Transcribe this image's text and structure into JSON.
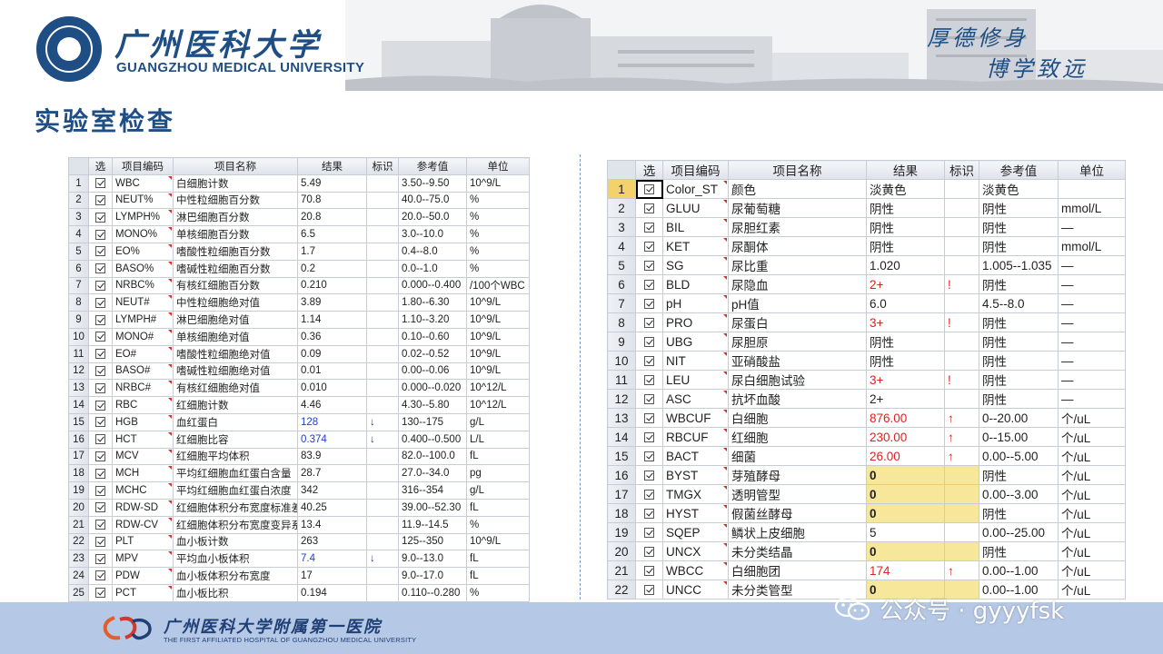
{
  "header": {
    "university_cn": "广州医科大学",
    "university_en": "GUANGZHOU MEDICAL UNIVERSITY",
    "motto_line1": "厚德修身",
    "motto_line2": "博学致远"
  },
  "title": "实验室检查",
  "table1": {
    "columns": [
      "选",
      "项目编码",
      "项目名称",
      "结果",
      "标识",
      "参考值",
      "单位"
    ],
    "rows": [
      [
        "WBC",
        "白细胞计数",
        "5.49",
        "",
        "3.50--9.50",
        "10^9/L",
        ""
      ],
      [
        "NEUT%",
        "中性粒细胞百分数",
        "70.8",
        "",
        "40.0--75.0",
        "%",
        ""
      ],
      [
        "LYMPH%",
        "淋巴细胞百分数",
        "20.8",
        "",
        "20.0--50.0",
        "%",
        ""
      ],
      [
        "MONO%",
        "单核细胞百分数",
        "6.5",
        "",
        "3.0--10.0",
        "%",
        ""
      ],
      [
        "EO%",
        "嗜酸性粒细胞百分数",
        "1.7",
        "",
        "0.4--8.0",
        "%",
        ""
      ],
      [
        "BASO%",
        "嗜碱性粒细胞百分数",
        "0.2",
        "",
        "0.0--1.0",
        "%",
        ""
      ],
      [
        "NRBC%",
        "有核红细胞百分数",
        "0.210",
        "",
        "0.000--0.400",
        "/100个WBC",
        ""
      ],
      [
        "NEUT#",
        "中性粒细胞绝对值",
        "3.89",
        "",
        "1.80--6.30",
        "10^9/L",
        ""
      ],
      [
        "LYMPH#",
        "淋巴细胞绝对值",
        "1.14",
        "",
        "1.10--3.20",
        "10^9/L",
        ""
      ],
      [
        "MONO#",
        "单核细胞绝对值",
        "0.36",
        "",
        "0.10--0.60",
        "10^9/L",
        ""
      ],
      [
        "EO#",
        "嗜酸性粒细胞绝对值",
        "0.09",
        "",
        "0.02--0.52",
        "10^9/L",
        ""
      ],
      [
        "BASO#",
        "嗜碱性粒细胞绝对值",
        "0.01",
        "",
        "0.00--0.06",
        "10^9/L",
        ""
      ],
      [
        "NRBC#",
        "有核红细胞绝对值",
        "0.010",
        "",
        "0.000--0.020",
        "10^12/L",
        ""
      ],
      [
        "RBC",
        "红细胞计数",
        "4.46",
        "",
        "4.30--5.80",
        "10^12/L",
        ""
      ],
      [
        "HGB",
        "血红蛋白",
        "128",
        "↓",
        "130--175",
        "g/L",
        "low"
      ],
      [
        "HCT",
        "红细胞比容",
        "0.374",
        "↓",
        "0.400--0.500",
        "L/L",
        "low"
      ],
      [
        "MCV",
        "红细胞平均体积",
        "83.9",
        "",
        "82.0--100.0",
        "fL",
        ""
      ],
      [
        "MCH",
        "平均红细胞血红蛋白含量",
        "28.7",
        "",
        "27.0--34.0",
        "pg",
        ""
      ],
      [
        "MCHC",
        "平均红细胞血红蛋白浓度",
        "342",
        "",
        "316--354",
        "g/L",
        ""
      ],
      [
        "RDW-SD",
        "红细胞体积分布宽度标准差",
        "40.25",
        "",
        "39.00--52.30",
        "fL",
        ""
      ],
      [
        "RDW-CV",
        "红细胞体积分布宽度变异系数",
        "13.4",
        "",
        "11.9--14.5",
        "%",
        ""
      ],
      [
        "PLT",
        "血小板计数",
        "263",
        "",
        "125--350",
        "10^9/L",
        ""
      ],
      [
        "MPV",
        "平均血小板体积",
        "7.4",
        "↓",
        "9.0--13.0",
        "fL",
        "low"
      ],
      [
        "PDW",
        "血小板体积分布宽度",
        "17",
        "",
        "9.0--17.0",
        "fL",
        ""
      ],
      [
        "PCT",
        "血小板比积",
        "0.194",
        "",
        "0.110--0.280",
        "%",
        ""
      ]
    ]
  },
  "table2": {
    "columns": [
      "选",
      "项目编码",
      "项目名称",
      "结果",
      "标识",
      "参考值",
      "单位"
    ],
    "rows": [
      [
        "Color_ST",
        "颜色",
        "淡黄色",
        "",
        "淡黄色",
        "",
        ""
      ],
      [
        "GLUU",
        "尿葡萄糖",
        "阴性",
        "",
        "阴性",
        "mmol/L",
        ""
      ],
      [
        "BIL",
        "尿胆红素",
        "阴性",
        "",
        "阴性",
        "—",
        ""
      ],
      [
        "KET",
        "尿酮体",
        "阴性",
        "",
        "阴性",
        "mmol/L",
        ""
      ],
      [
        "SG",
        "尿比重",
        "1.020",
        "",
        "1.005--1.035",
        "—",
        ""
      ],
      [
        "BLD",
        "尿隐血",
        "2+",
        "!",
        "阴性",
        "—",
        "abn"
      ],
      [
        "pH",
        "pH值",
        "6.0",
        "",
        "4.5--8.0",
        "—",
        ""
      ],
      [
        "PRO",
        "尿蛋白",
        "3+",
        "!",
        "阴性",
        "—",
        "abn"
      ],
      [
        "UBG",
        "尿胆原",
        "阴性",
        "",
        "阴性",
        "—",
        ""
      ],
      [
        "NIT",
        "亚硝酸盐",
        "阴性",
        "",
        "阴性",
        "—",
        ""
      ],
      [
        "LEU",
        "尿白细胞试验",
        "3+",
        "!",
        "阴性",
        "—",
        "abn"
      ],
      [
        "ASC",
        "抗坏血酸",
        "2+",
        "",
        "阴性",
        "—",
        ""
      ],
      [
        "WBCUF",
        "白细胞",
        "876.00",
        "↑",
        "0--20.00",
        "个/uL",
        "high"
      ],
      [
        "RBCUF",
        "红细胞",
        "230.00",
        "↑",
        "0--15.00",
        "个/uL",
        "high"
      ],
      [
        "BACT",
        "细菌",
        "26.00",
        "↑",
        "0.00--5.00",
        "个/uL",
        "high"
      ],
      [
        "BYST",
        "芽殖酵母",
        "0",
        "",
        "阴性",
        "个/uL",
        "hl"
      ],
      [
        "TMGX",
        "透明管型",
        "0",
        "",
        "0.00--3.00",
        "个/uL",
        "hl"
      ],
      [
        "HYST",
        "假菌丝酵母",
        "0",
        "",
        "阴性",
        "个/uL",
        "hl"
      ],
      [
        "SQEP",
        "鳞状上皮细胞",
        "5",
        "",
        "0.00--25.00",
        "个/uL",
        ""
      ],
      [
        "UNCX",
        "未分类结晶",
        "0",
        "",
        "阴性",
        "个/uL",
        "hl"
      ],
      [
        "WBCC",
        "白细胞团",
        "174",
        "↑",
        "0.00--1.00",
        "个/uL",
        "high"
      ],
      [
        "UNCC",
        "未分类管型",
        "0",
        "",
        "0.00--1.00",
        "个/uL",
        "hl"
      ]
    ]
  },
  "footer": {
    "hospital_cn": "广州医科大学附属第一医院",
    "hospital_en": "THE FIRST AFFILIATED HOSPITAL OF GUANGZHOU MEDICAL UNIVERSITY",
    "watermark": "公众号 · gyyyfsk"
  },
  "colors": {
    "brand_blue": "#1f4e85",
    "footer_bg": "#b5c8e6",
    "low_flag": "#1a3fcf",
    "high_flag": "#e02020",
    "highlight": "#f7e79a"
  }
}
